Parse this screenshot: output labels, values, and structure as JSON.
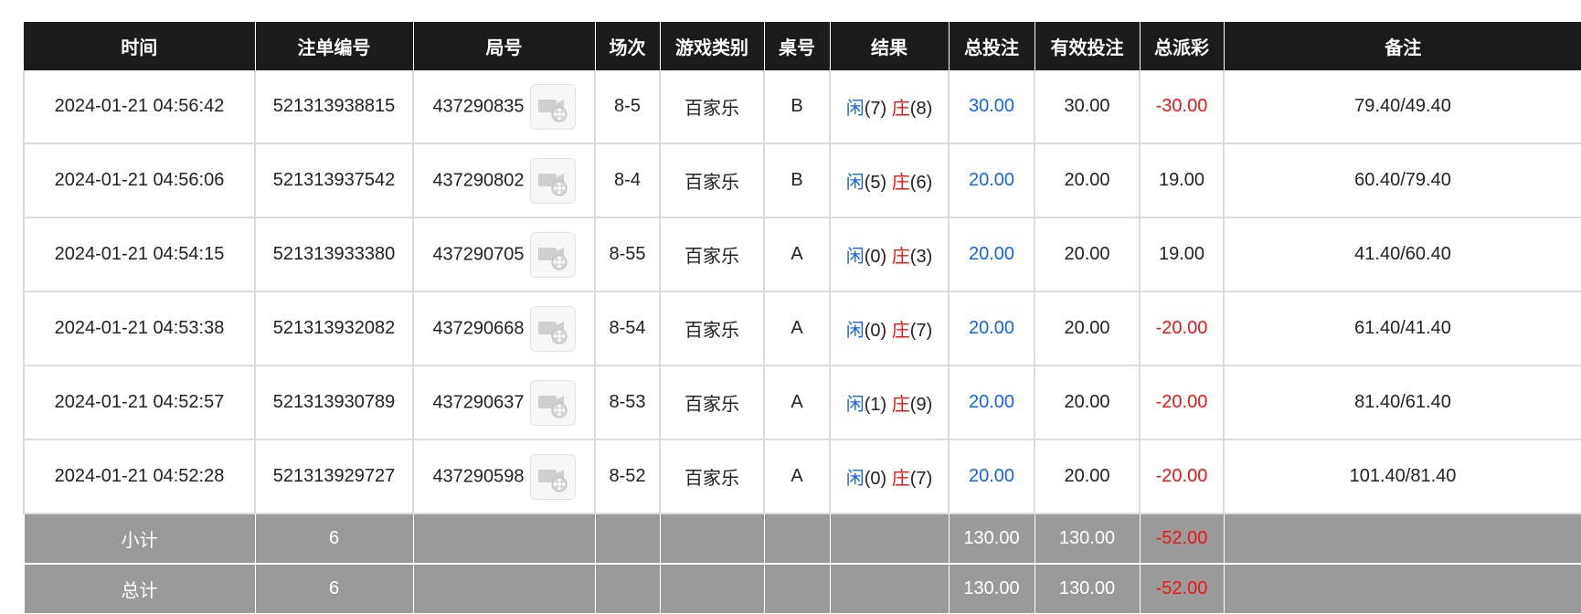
{
  "table": {
    "headers": [
      "时间",
      "注单编号",
      "局号",
      "场次",
      "游戏类别",
      "桌号",
      "结果",
      "总投注",
      "有效投注",
      "总派彩",
      "备注"
    ],
    "rows": [
      {
        "time": "2024-01-21 04:56:42",
        "bet_id": "521313938815",
        "round": "437290835",
        "session": "8-5",
        "game": "百家乐",
        "table_no": "B",
        "player_label": "闲",
        "player_score": "(7)",
        "banker_label": "庄",
        "banker_score": "(8)",
        "total_bet": "30.00",
        "valid_bet": "30.00",
        "payout": "-30.00",
        "payout_negative": true,
        "remark": "79.40/49.40"
      },
      {
        "time": "2024-01-21 04:56:06",
        "bet_id": "521313937542",
        "round": "437290802",
        "session": "8-4",
        "game": "百家乐",
        "table_no": "B",
        "player_label": "闲",
        "player_score": "(5)",
        "banker_label": "庄",
        "banker_score": "(6)",
        "total_bet": "20.00",
        "valid_bet": "20.00",
        "payout": "19.00",
        "payout_negative": false,
        "remark": "60.40/79.40"
      },
      {
        "time": "2024-01-21 04:54:15",
        "bet_id": "521313933380",
        "round": "437290705",
        "session": "8-55",
        "game": "百家乐",
        "table_no": "A",
        "player_label": "闲",
        "player_score": "(0)",
        "banker_label": "庄",
        "banker_score": "(3)",
        "total_bet": "20.00",
        "valid_bet": "20.00",
        "payout": "19.00",
        "payout_negative": false,
        "remark": "41.40/60.40"
      },
      {
        "time": "2024-01-21 04:53:38",
        "bet_id": "521313932082",
        "round": "437290668",
        "session": "8-54",
        "game": "百家乐",
        "table_no": "A",
        "player_label": "闲",
        "player_score": "(0)",
        "banker_label": "庄",
        "banker_score": "(7)",
        "total_bet": "20.00",
        "valid_bet": "20.00",
        "payout": "-20.00",
        "payout_negative": true,
        "remark": "61.40/41.40"
      },
      {
        "time": "2024-01-21 04:52:57",
        "bet_id": "521313930789",
        "round": "437290637",
        "session": "8-53",
        "game": "百家乐",
        "table_no": "A",
        "player_label": "闲",
        "player_score": "(1)",
        "banker_label": "庄",
        "banker_score": "(9)",
        "total_bet": "20.00",
        "valid_bet": "20.00",
        "payout": "-20.00",
        "payout_negative": true,
        "remark": "81.40/61.40"
      },
      {
        "time": "2024-01-21 04:52:28",
        "bet_id": "521313929727",
        "round": "437290598",
        "session": "8-52",
        "game": "百家乐",
        "table_no": "A",
        "player_label": "闲",
        "player_score": "(0)",
        "banker_label": "庄",
        "banker_score": "(7)",
        "total_bet": "20.00",
        "valid_bet": "20.00",
        "payout": "-20.00",
        "payout_negative": true,
        "remark": "101.40/81.40"
      }
    ],
    "subtotal": {
      "label": "小计",
      "count": "6",
      "total_bet": "130.00",
      "valid_bet": "130.00",
      "payout": "-52.00"
    },
    "grandtotal": {
      "label": "总计",
      "count": "6",
      "total_bet": "130.00",
      "valid_bet": "130.00",
      "payout": "-52.00"
    },
    "round_video_icon": "video-replay-icon"
  },
  "colors": {
    "header_bg": "#1b1b1b",
    "summary_bg": "#9a9a9a",
    "blue": "#1565e8",
    "red": "#f01414"
  }
}
